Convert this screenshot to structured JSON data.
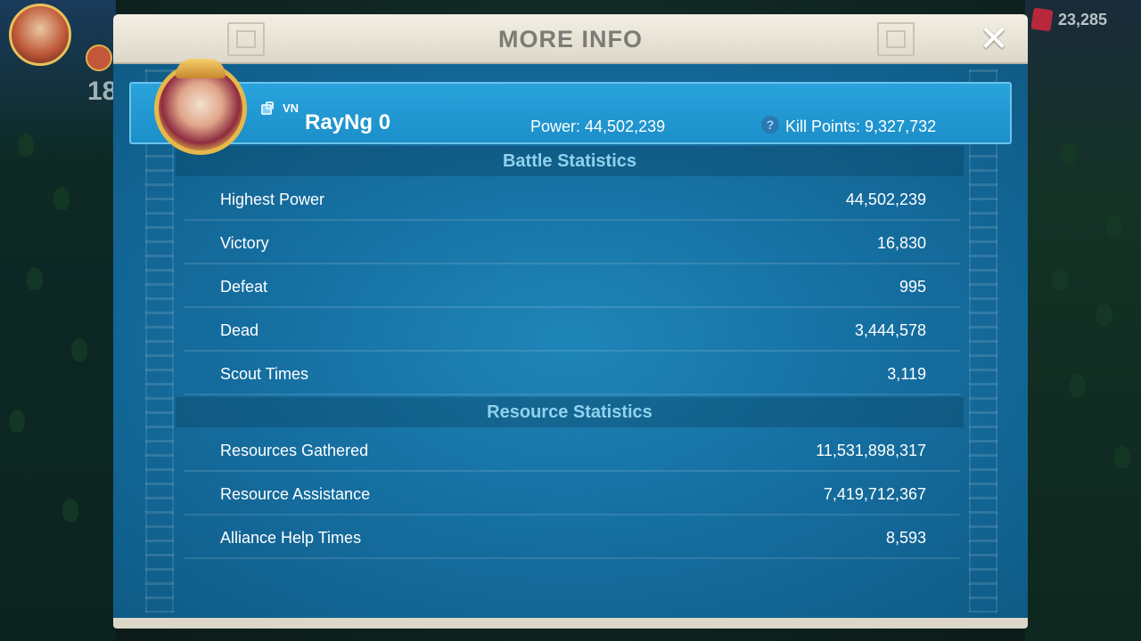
{
  "hud": {
    "left_number": "18",
    "gems": "23,285"
  },
  "modal": {
    "title": "MORE INFO",
    "close_glyph": "✕"
  },
  "player": {
    "country_tag": "VN",
    "name": "RayNg 0",
    "power": "Power: 44,502,239",
    "kill_points": "Kill Points: 9,327,732"
  },
  "battle_statistics": {
    "title": "Battle Statistics",
    "rows": [
      {
        "label": "Highest Power",
        "value": "44,502,239"
      },
      {
        "label": "Victory",
        "value": "16,830"
      },
      {
        "label": "Defeat",
        "value": "995"
      },
      {
        "label": "Dead",
        "value": "3,444,578"
      },
      {
        "label": "Scout Times",
        "value": "3,119"
      }
    ]
  },
  "resource_statistics": {
    "title": "Resource Statistics",
    "rows": [
      {
        "label": "Resources Gathered",
        "value": "11,531,898,317"
      },
      {
        "label": "Resource Assistance",
        "value": "7,419,712,367"
      },
      {
        "label": "Alliance Help Times",
        "value": "8,593"
      }
    ]
  }
}
